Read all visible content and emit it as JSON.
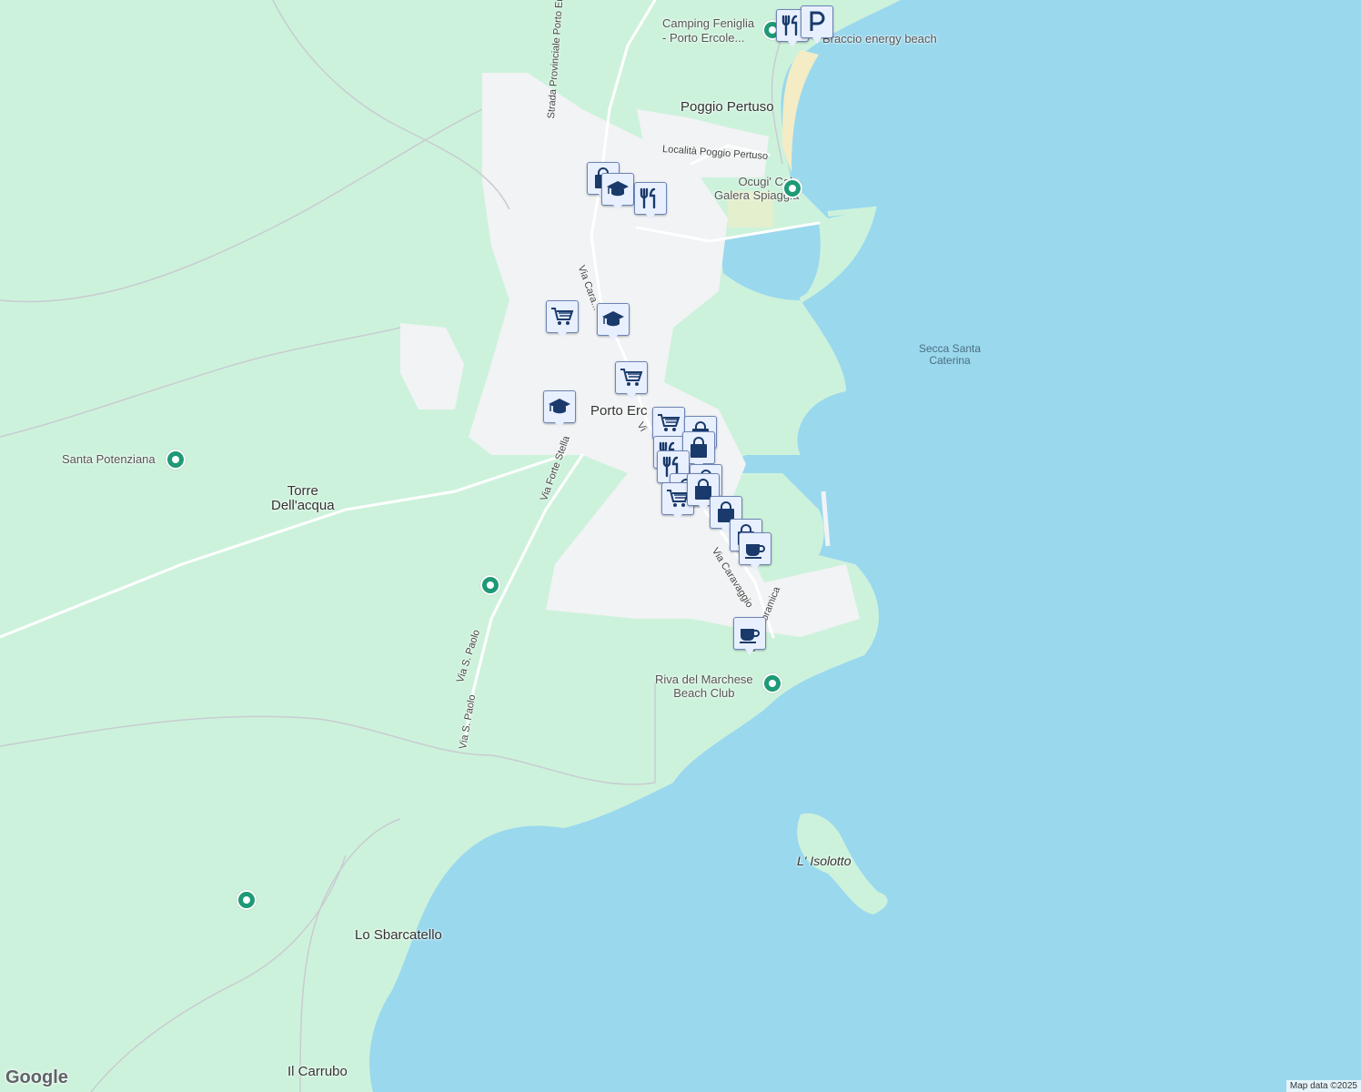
{
  "labels": {
    "camping": "Camping Feniglia\n- Porto Ercole...",
    "braccio": "Braccio energy beach",
    "poggio": "Poggio Pertuso",
    "loc_poggio": "Località Poggio Pertuso",
    "ocugi": "Ocugi' Cala\nGalera Spiaggia",
    "secca": "Secca Santa\nCaterina",
    "porto": "Porto Erc",
    "santa_pot": "Santa Potenziana",
    "torre": "Torre\nDell'acqua",
    "riva": "Riva del Marchese\nBeach Club",
    "isolotto": "L' Isolotto",
    "sbarcatello": "Lo Sbarcatello",
    "carrubo": "Il Carrubo",
    "road_sp": "Strada Provinciale Porto Ercole",
    "road_cara": "Via Cara...",
    "road_forte": "Via Forte Stella",
    "road_caravaggio": "Via Caravaggio",
    "road_panoramica": "Via Panoramica",
    "road_spaolo1": "Via S. Paolo",
    "road_spaolo2": "Via S. Paolo",
    "road_v": "Vi"
  },
  "footer": {
    "logo": "Google",
    "attribution": "Map data ©2025"
  },
  "colors": {
    "land": "#cdf2dc",
    "water": "#9ad8ee",
    "urban": "#f1f3f4",
    "poi": "#1e9a76",
    "icon": "#1a3a6b"
  },
  "markers": [
    {
      "type": "restaurant-icon"
    },
    {
      "type": "parking-icon"
    },
    {
      "type": "shopping-bag-icon"
    },
    {
      "type": "school-icon"
    },
    {
      "type": "restaurant-icon"
    },
    {
      "type": "shopping-cart-icon"
    },
    {
      "type": "school-icon"
    },
    {
      "type": "shopping-cart-icon"
    },
    {
      "type": "school-icon"
    },
    {
      "type": "shopping-cart-icon"
    },
    {
      "type": "shopping-bag-icon"
    },
    {
      "type": "restaurant-icon"
    },
    {
      "type": "shopping-bag-icon"
    },
    {
      "type": "restaurant-icon"
    },
    {
      "type": "shopping-bag-icon"
    },
    {
      "type": "shopping-bag-icon"
    },
    {
      "type": "shopping-cart-icon"
    },
    {
      "type": "shopping-bag-icon"
    },
    {
      "type": "shopping-bag-icon"
    },
    {
      "type": "shopping-bag-icon"
    },
    {
      "type": "coffee-icon"
    },
    {
      "type": "coffee-icon"
    }
  ]
}
